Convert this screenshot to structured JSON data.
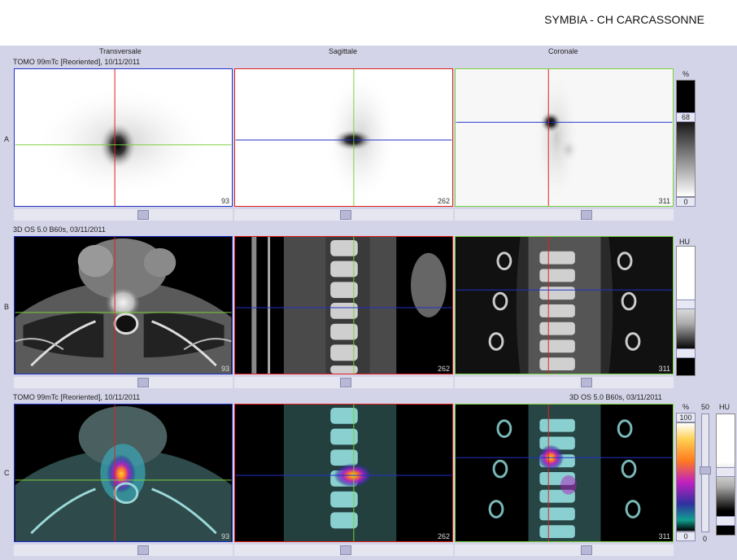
{
  "header": {
    "site_title": "SYMBIA - CH CARCASSONNE"
  },
  "columns": {
    "transverse": "Transversale",
    "sagittal": "Sagittale",
    "coronal": "Coronale"
  },
  "rows": {
    "a": {
      "letter": "A",
      "series": "TOMO 99mTc [Reoriented], 10/11/2011"
    },
    "b": {
      "letter": "B",
      "series": "3D  OS  5.0  B60s, 03/11/2011"
    },
    "c": {
      "letter": "C",
      "series_left": "TOMO 99mTc [Reoriented], 10/11/2011",
      "series_right": "3D  OS  5.0  B60s, 03/11/2011"
    }
  },
  "slices": {
    "transverse": "93",
    "sagittal": "262",
    "coronal": "311"
  },
  "scales": {
    "a": {
      "unit": "%",
      "level": "68",
      "min": "0"
    },
    "b": {
      "unit": "HU"
    },
    "c": {
      "unit_pct": "%",
      "max": "100",
      "min": "0",
      "unit_hu": "HU",
      "hu_top": "50",
      "hu_bottom": "0"
    }
  },
  "colors": {
    "crosshair_red": "#e02020",
    "crosshair_green": "#7ad03a",
    "crosshair_blue": "#2030c8",
    "background": "#d4d4e8"
  }
}
